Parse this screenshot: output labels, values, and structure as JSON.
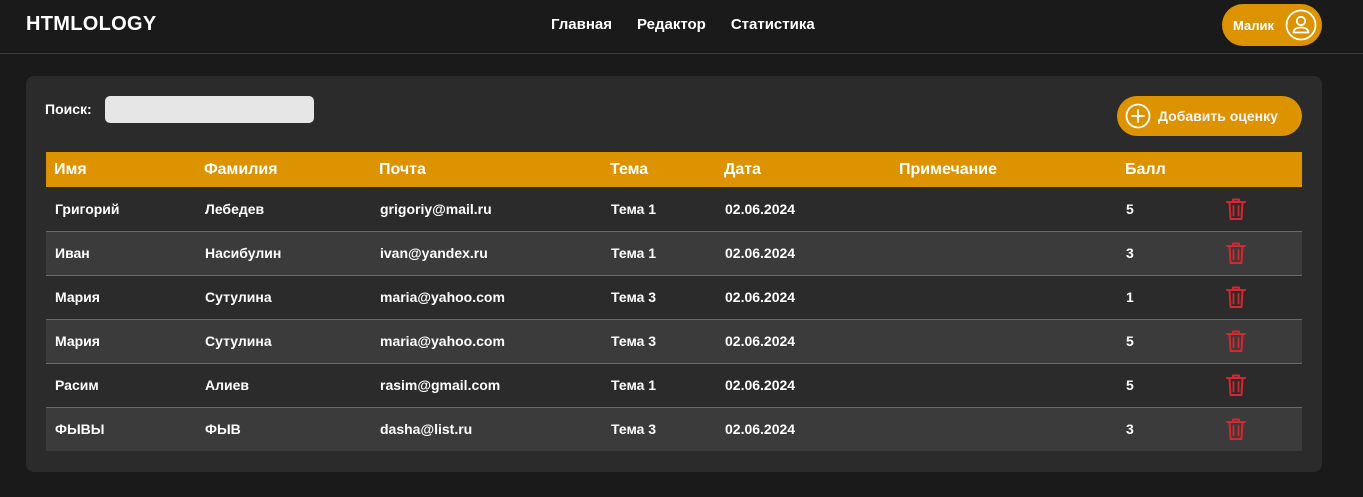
{
  "header": {
    "logo": "HTMLOLOGY",
    "nav": [
      "Главная",
      "Редактор",
      "Статистика"
    ],
    "user_name": "Малик"
  },
  "toolbar": {
    "search_label": "Поиск:",
    "search_value": "",
    "add_label": "Добавить оценку"
  },
  "table": {
    "columns": [
      "Имя",
      "Фамилия",
      "Почта",
      "Тема",
      "Дата",
      "Примечание",
      "Балл"
    ],
    "rows": [
      {
        "name": "Григорий",
        "surname": "Лебедев",
        "email": "grigoriy@mail.ru",
        "topic": "Тема 1",
        "date": "02.06.2024",
        "note": "",
        "score": "5"
      },
      {
        "name": "Иван",
        "surname": "Насибулин",
        "email": "ivan@yandex.ru",
        "topic": "Тема 1",
        "date": "02.06.2024",
        "note": "",
        "score": "3"
      },
      {
        "name": "Мария",
        "surname": "Сутулина",
        "email": "maria@yahoo.com",
        "topic": "Тема 3",
        "date": "02.06.2024",
        "note": "",
        "score": "1"
      },
      {
        "name": "Мария",
        "surname": "Сутулина",
        "email": "maria@yahoo.com",
        "topic": "Тема 3",
        "date": "02.06.2024",
        "note": "",
        "score": "5"
      },
      {
        "name": "Расим",
        "surname": "Алиев",
        "email": "rasim@gmail.com",
        "topic": "Тема 1",
        "date": "02.06.2024",
        "note": "",
        "score": "5"
      },
      {
        "name": "ФЫВЫ",
        "surname": "ФЫВ",
        "email": "dasha@list.ru",
        "topic": "Тема 3",
        "date": "02.06.2024",
        "note": "",
        "score": "3"
      }
    ],
    "delete_icon": "trash-icon"
  },
  "colors": {
    "accent": "#dd9200",
    "background": "#1a1a1a",
    "card": "#2b2b2b",
    "row_alt": "#3b3b3b",
    "delete": "#d9262c"
  }
}
